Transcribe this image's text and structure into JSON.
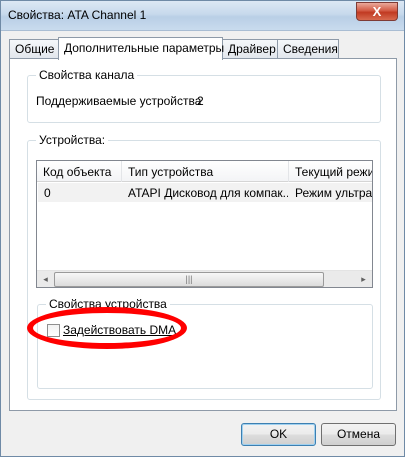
{
  "window": {
    "title": "Свойства: ATA Channel 1",
    "close_label": "X"
  },
  "tabs": [
    {
      "label": "Общие"
    },
    {
      "label": "Дополнительные параметры"
    },
    {
      "label": "Драйвер"
    },
    {
      "label": "Сведения"
    }
  ],
  "channel_group": {
    "title": "Свойства канала",
    "supported_label": "Поддерживаемые устройства",
    "supported_value": "2"
  },
  "devices_group": {
    "title": "Устройства:",
    "columns": [
      "Код объекта",
      "Тип устройства",
      "Текущий режи"
    ],
    "rows": [
      [
        "0",
        "ATAPI Дисковод для компак...",
        "Режим ультра"
      ]
    ]
  },
  "scrollbar": {
    "left_arrow": "◂",
    "right_arrow": "▸",
    "thumb_grip": "|||"
  },
  "device_props_group": {
    "title": "Свойства устройства",
    "dma_label": "Задействовать DMA",
    "dma_checked": false
  },
  "buttons": {
    "ok": "OK",
    "cancel": "Отмена"
  },
  "colors": {
    "highlight_marker": "#ff0000"
  }
}
